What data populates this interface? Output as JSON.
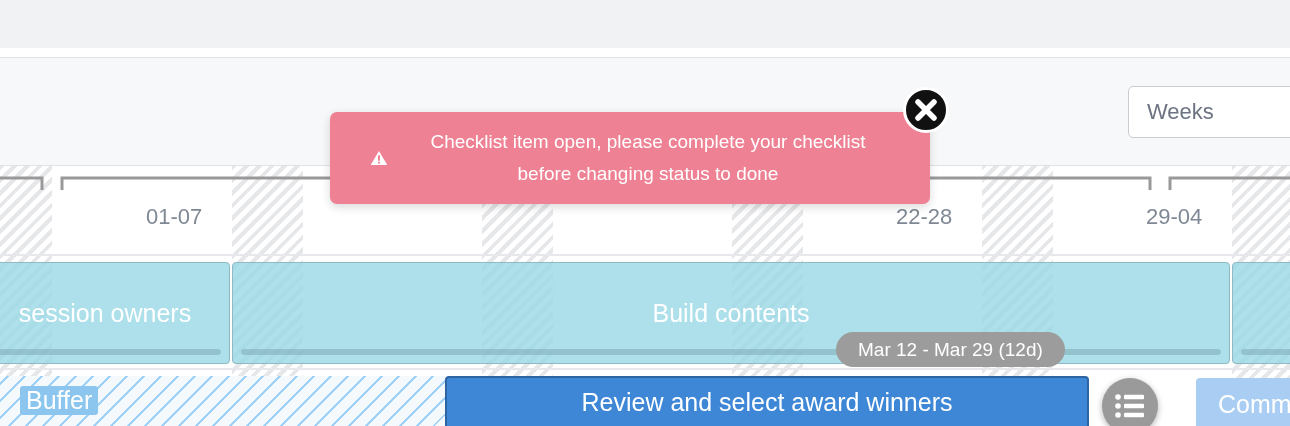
{
  "toolbar": {
    "scale_select": {
      "value": "Weeks"
    }
  },
  "timeline": {
    "week_labels": [
      {
        "label": "01-07"
      },
      {
        "label": "22-28"
      },
      {
        "label": "29-04"
      }
    ]
  },
  "rows": [
    {
      "bars": [
        {
          "kind": "task",
          "label": "session owners"
        },
        {
          "kind": "task",
          "label": "Build contents",
          "date_badge": "Mar 12 - Mar 29 (12d)"
        },
        {
          "kind": "task"
        }
      ]
    },
    {
      "bars": [
        {
          "kind": "buffer",
          "label": "Buffer"
        },
        {
          "kind": "selected",
          "label": "Review and select award winners"
        },
        {
          "kind": "checklist"
        },
        {
          "kind": "next",
          "label": "Comm"
        }
      ]
    }
  ],
  "toast": {
    "message": "Checklist item open, please complete your checklist before changing status to done"
  }
}
